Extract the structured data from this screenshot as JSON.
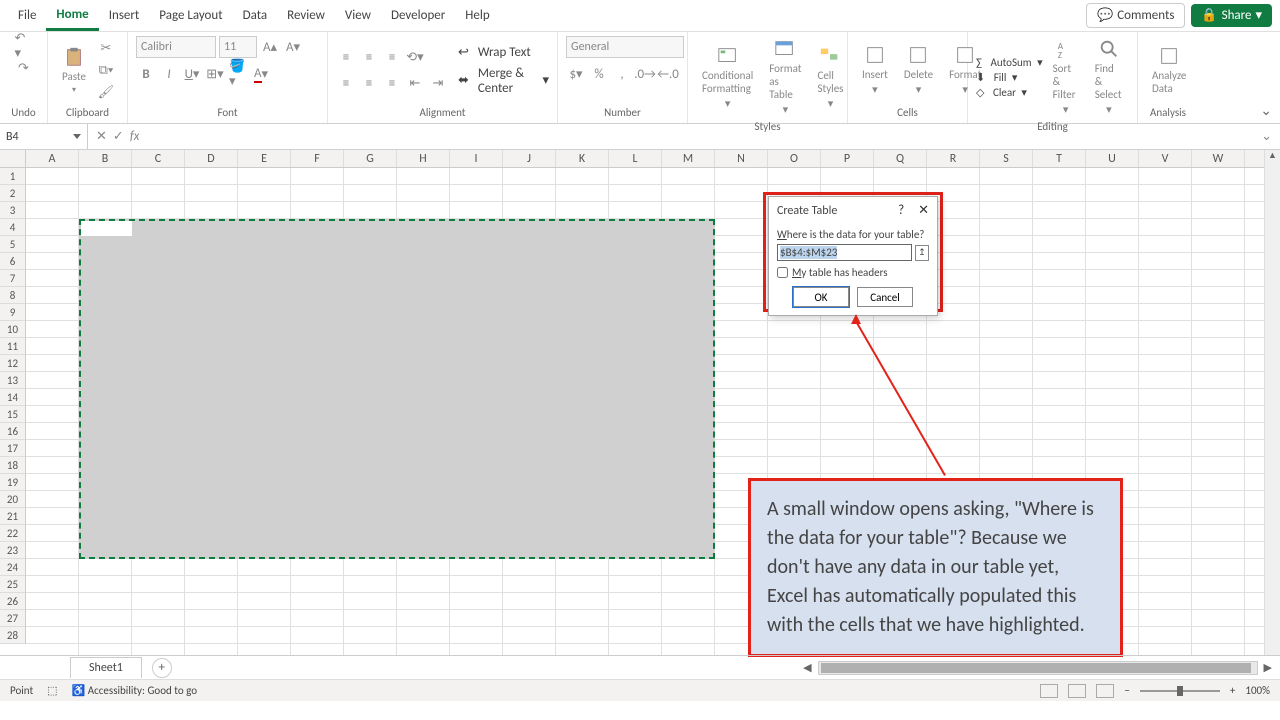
{
  "menu": {
    "items": [
      "File",
      "Home",
      "Insert",
      "Page Layout",
      "Data",
      "Review",
      "View",
      "Developer",
      "Help"
    ],
    "active": "Home",
    "comments": "Comments",
    "share": "Share"
  },
  "ribbon": {
    "undo": "Undo",
    "clipboard": "Clipboard",
    "paste": "Paste",
    "font_group": "Font",
    "font_name": "Calibri",
    "font_size": "11",
    "alignment": "Alignment",
    "wrap": "Wrap Text",
    "merge": "Merge & Center",
    "number": "Number",
    "number_format": "General",
    "styles": "Styles",
    "cond_fmt": "Conditional Formatting",
    "fmt_table": "Format as Table",
    "cell_styles": "Cell Styles",
    "cells": "Cells",
    "insert": "Insert",
    "delete": "Delete",
    "format": "Format",
    "editing": "Editing",
    "autosum": "AutoSum",
    "fill": "Fill",
    "clear": "Clear",
    "sort": "Sort & Filter",
    "find": "Find & Select",
    "analysis": "Analysis",
    "analyze": "Analyze Data"
  },
  "formula": {
    "cell_ref": "B4",
    "fx": "fx"
  },
  "grid": {
    "cols": [
      "A",
      "B",
      "C",
      "D",
      "E",
      "F",
      "G",
      "H",
      "I",
      "J",
      "K",
      "L",
      "M",
      "N",
      "O",
      "P",
      "Q",
      "R",
      "S",
      "T",
      "U",
      "V",
      "W"
    ],
    "rows": 28
  },
  "dialog": {
    "title": "Create Table",
    "prompt": "Where is the data for your table?",
    "range": "$B$4:$M$23",
    "headers_label": "My table has headers",
    "ok": "OK",
    "cancel": "Cancel"
  },
  "callout": "A small window opens asking, \"Where is the data for your table\"? Because we don't have any data in our table yet, Excel has automatically populated this with the cells that we have highlighted.",
  "sheet": {
    "name": "Sheet1"
  },
  "status": {
    "mode": "Point",
    "a11y": "Accessibility: Good to go",
    "zoom": "100%"
  }
}
